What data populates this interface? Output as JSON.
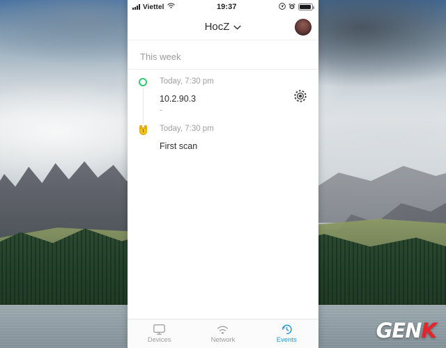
{
  "background": {
    "description": "mountain-lake-photo",
    "watermark": {
      "part1": "GEN",
      "part2": "K"
    }
  },
  "phone": {
    "statusbar": {
      "carrier": "Viettel",
      "signal_icon": "cellular-signal-icon",
      "wifi_icon": "wifi-icon",
      "time": "19:37",
      "location_icon": "location-arrow-icon",
      "alarm_icon": "alarm-clock-icon",
      "battery_icon": "battery-icon"
    },
    "navbar": {
      "title": "HocZ",
      "chevron_icon": "chevron-down-icon",
      "avatar": "user-avatar"
    },
    "content": {
      "section_title": "This week",
      "events": [
        {
          "marker_icon": "green-circle-icon",
          "time": "Today, 7:30 pm",
          "primary": "10.2.90.3",
          "secondary": "-",
          "action_icon": "scan-radar-icon"
        },
        {
          "marker_icon": "medal-badge-icon",
          "time": "Today, 7:30 pm",
          "primary": "First scan",
          "secondary": "",
          "action_icon": ""
        }
      ]
    },
    "tabbar": {
      "tabs": [
        {
          "label": "Devices",
          "icon": "monitor-icon",
          "active": false
        },
        {
          "label": "Network",
          "icon": "wifi-icon",
          "active": false
        },
        {
          "label": "Events",
          "icon": "clock-rewind-icon",
          "active": true
        }
      ],
      "active_color": "#1c9ad6",
      "inactive_color": "#9b9b9b"
    }
  }
}
